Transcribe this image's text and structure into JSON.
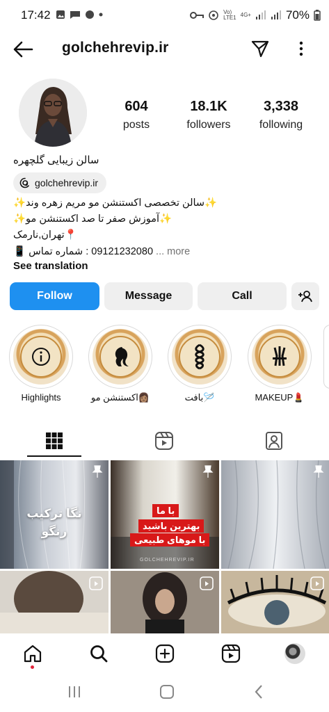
{
  "status": {
    "time": "17:42",
    "battery": "70%",
    "net": "4G+"
  },
  "header": {
    "username": "golchehrevip.ir"
  },
  "profile": {
    "stats": [
      {
        "num": "604",
        "label": "posts"
      },
      {
        "num": "18.1K",
        "label": "followers"
      },
      {
        "num": "3,338",
        "label": "following"
      }
    ],
    "fullname": "سالن زیبایی گلچهره",
    "threads_handle": "golchehrevip.ir",
    "bio": [
      "✨سالن تخصصی اکستنشن مو مریم زهره وند✨",
      "✨آموزش صفر تا صد اکستنشن مو✨",
      "📍تهران,نارمک",
      "09121232080 : شماره تماس 📱"
    ],
    "more": "... more",
    "see_translation": "See translation"
  },
  "buttons": {
    "follow": "Follow",
    "message": "Message",
    "call": "Call"
  },
  "highlights": [
    {
      "label": "Highlights",
      "icon": "info-icon"
    },
    {
      "label": "اکستنشن مو👩🏽",
      "icon": "woman-profile-icon"
    },
    {
      "label": "بافت🪡",
      "icon": "braid-icon"
    },
    {
      "label": "MAKEUP💄",
      "icon": "makeup-brushes-icon"
    }
  ],
  "tabs": [
    "grid-icon",
    "reels-icon",
    "tagged-icon"
  ],
  "grid": {
    "post1_text": "نگا ترکیب رنگو",
    "post2_lines": [
      "با ما",
      "بهترین باشید",
      "با موهای طبیعی"
    ],
    "watermark": "GOLCHEHREVIP.IR"
  },
  "colors": {
    "follow_blue": "#1e90f0",
    "highlight_gold": "#c58c3e"
  }
}
